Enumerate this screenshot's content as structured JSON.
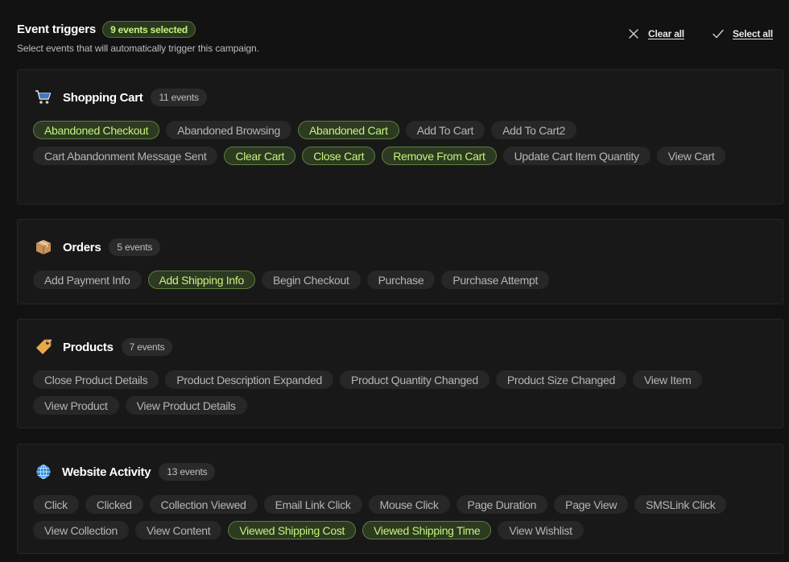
{
  "header": {
    "title": "Event triggers",
    "selected_badge": "9 events selected",
    "subtitle": "Select events that will automatically trigger this campaign.",
    "clear_all": "Clear all",
    "select_all": "Select all"
  },
  "colors": {
    "background": "#121212",
    "card": "#181818",
    "chip": "#272727",
    "selected_chip_bg": "#2b3a21",
    "selected_chip_border": "#607d40",
    "selected_text": "#c8f27c"
  },
  "sections": [
    {
      "icon": "shopping-cart-icon",
      "title": "Shopping Cart",
      "count": "11 events",
      "events": [
        {
          "label": "Abandoned Checkout",
          "selected": true
        },
        {
          "label": "Abandoned Browsing",
          "selected": false
        },
        {
          "label": "Abandoned Cart",
          "selected": true
        },
        {
          "label": "Add To Cart",
          "selected": false
        },
        {
          "label": "Add To Cart2",
          "selected": false
        },
        {
          "label": "Cart Abandonment Message Sent",
          "selected": false
        },
        {
          "label": "Clear Cart",
          "selected": true
        },
        {
          "label": "Close Cart",
          "selected": true
        },
        {
          "label": "Remove From Cart",
          "selected": true
        },
        {
          "label": "Update Cart Item Quantity",
          "selected": false
        },
        {
          "label": "View Cart",
          "selected": false
        }
      ]
    },
    {
      "icon": "package-icon",
      "title": "Orders",
      "count": "5 events",
      "events": [
        {
          "label": "Add Payment Info",
          "selected": false
        },
        {
          "label": "Add Shipping Info",
          "selected": true
        },
        {
          "label": "Begin Checkout",
          "selected": false
        },
        {
          "label": "Purchase",
          "selected": false
        },
        {
          "label": "Purchase Attempt",
          "selected": false
        }
      ]
    },
    {
      "icon": "price-tag-icon",
      "title": "Products",
      "count": "7 events",
      "events": [
        {
          "label": "Close Product Details",
          "selected": false
        },
        {
          "label": "Product Description Expanded",
          "selected": false
        },
        {
          "label": "Product Quantity Changed",
          "selected": false
        },
        {
          "label": "Product Size Changed",
          "selected": false
        },
        {
          "label": "View Item",
          "selected": false
        },
        {
          "label": "View Product",
          "selected": false
        },
        {
          "label": "View Product Details",
          "selected": false
        }
      ]
    },
    {
      "icon": "globe-icon",
      "title": "Website Activity",
      "count": "13 events",
      "events": [
        {
          "label": "Click",
          "selected": false
        },
        {
          "label": "Clicked",
          "selected": false
        },
        {
          "label": "Collection Viewed",
          "selected": false
        },
        {
          "label": "Email Link Click",
          "selected": false
        },
        {
          "label": "Mouse Click",
          "selected": false
        },
        {
          "label": "Page Duration",
          "selected": false
        },
        {
          "label": "Page View",
          "selected": false
        },
        {
          "label": "SMSLink Click",
          "selected": false
        },
        {
          "label": "View Collection",
          "selected": false
        },
        {
          "label": "View Content",
          "selected": false
        },
        {
          "label": "Viewed Shipping Cost",
          "selected": true
        },
        {
          "label": "Viewed Shipping Time",
          "selected": true
        },
        {
          "label": "View Wishlist",
          "selected": false
        }
      ]
    }
  ]
}
